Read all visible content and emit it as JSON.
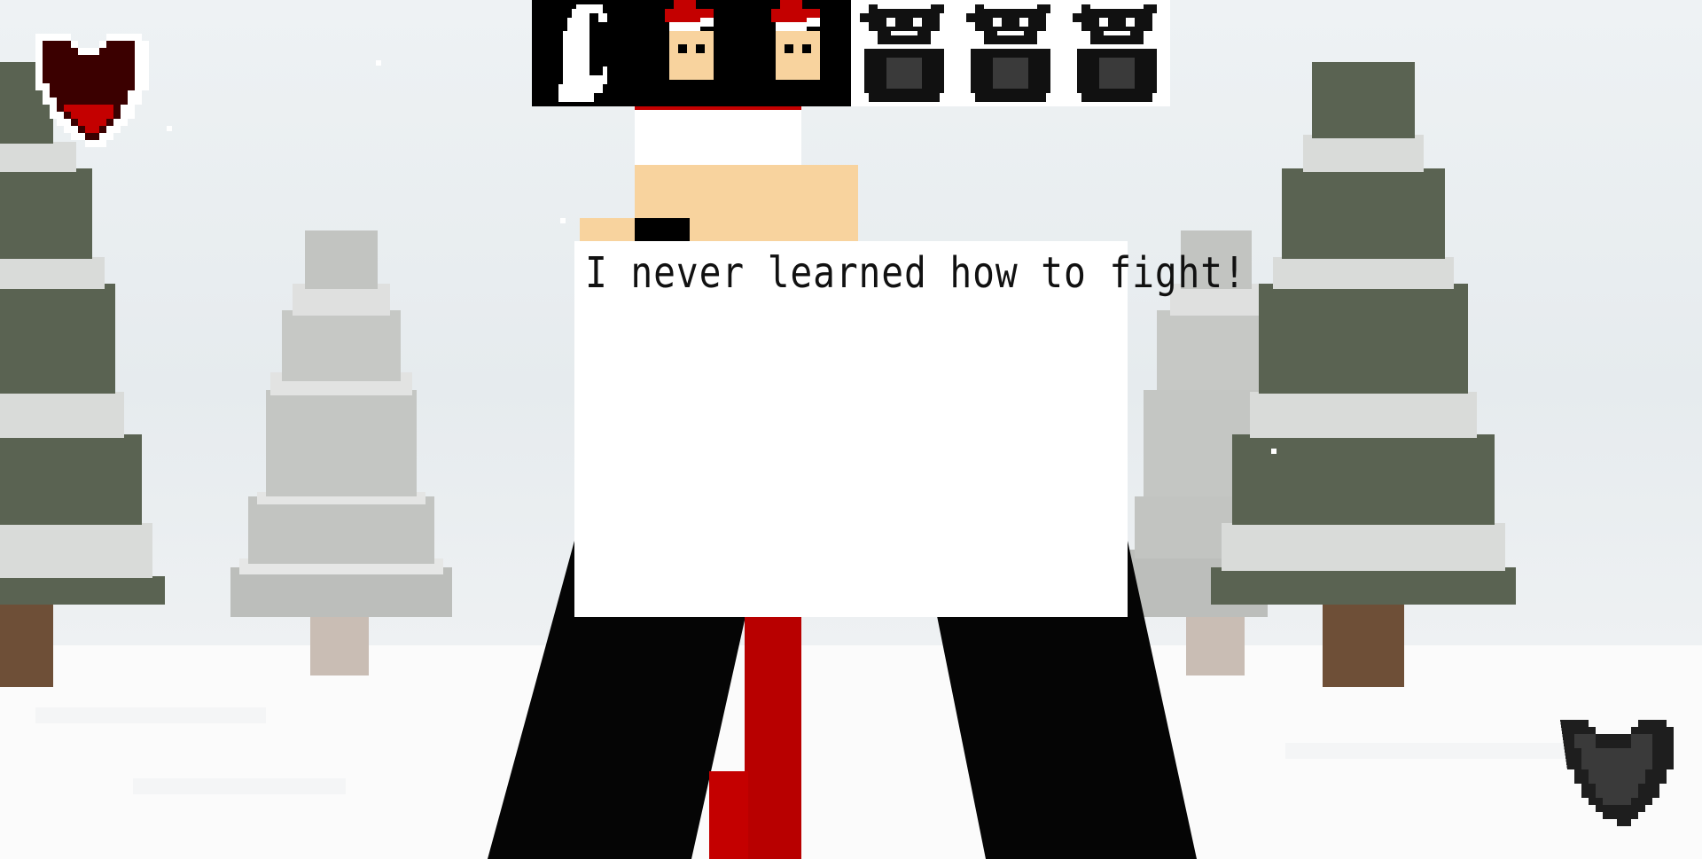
{
  "dialogue": {
    "text": "I never learned how to fight!"
  },
  "hud": {
    "player_heart": {
      "icon": "red-pixel-heart-icon",
      "fill_fraction": 0.25,
      "color": "#c40000"
    },
    "enemy_heart": {
      "icon": "gray-pixel-heart-icon",
      "color": "#3a3a3a"
    }
  },
  "party": [
    {
      "name": "ghost",
      "icon": "ghost-portrait-icon",
      "team": "ally"
    },
    {
      "name": "santa-hat-kid-1",
      "icon": "santa-hat-face-icon",
      "team": "ally"
    },
    {
      "name": "santa-hat-kid-2",
      "icon": "santa-hat-face-icon",
      "team": "ally"
    },
    {
      "name": "bunny-1",
      "icon": "dark-bunny-portrait-icon",
      "team": "enemy"
    },
    {
      "name": "bunny-2",
      "icon": "dark-bunny-portrait-icon",
      "team": "enemy"
    },
    {
      "name": "bunny-3",
      "icon": "dark-bunny-portrait-icon",
      "team": "enemy"
    }
  ],
  "colors": {
    "tree_dark": "#5a6352",
    "tree_snow": "#d9dbd9",
    "tree_far": "#bcbebb",
    "trunk": "#6e4f37",
    "santa_red": "#c40000",
    "skin": "#f8d39e"
  }
}
